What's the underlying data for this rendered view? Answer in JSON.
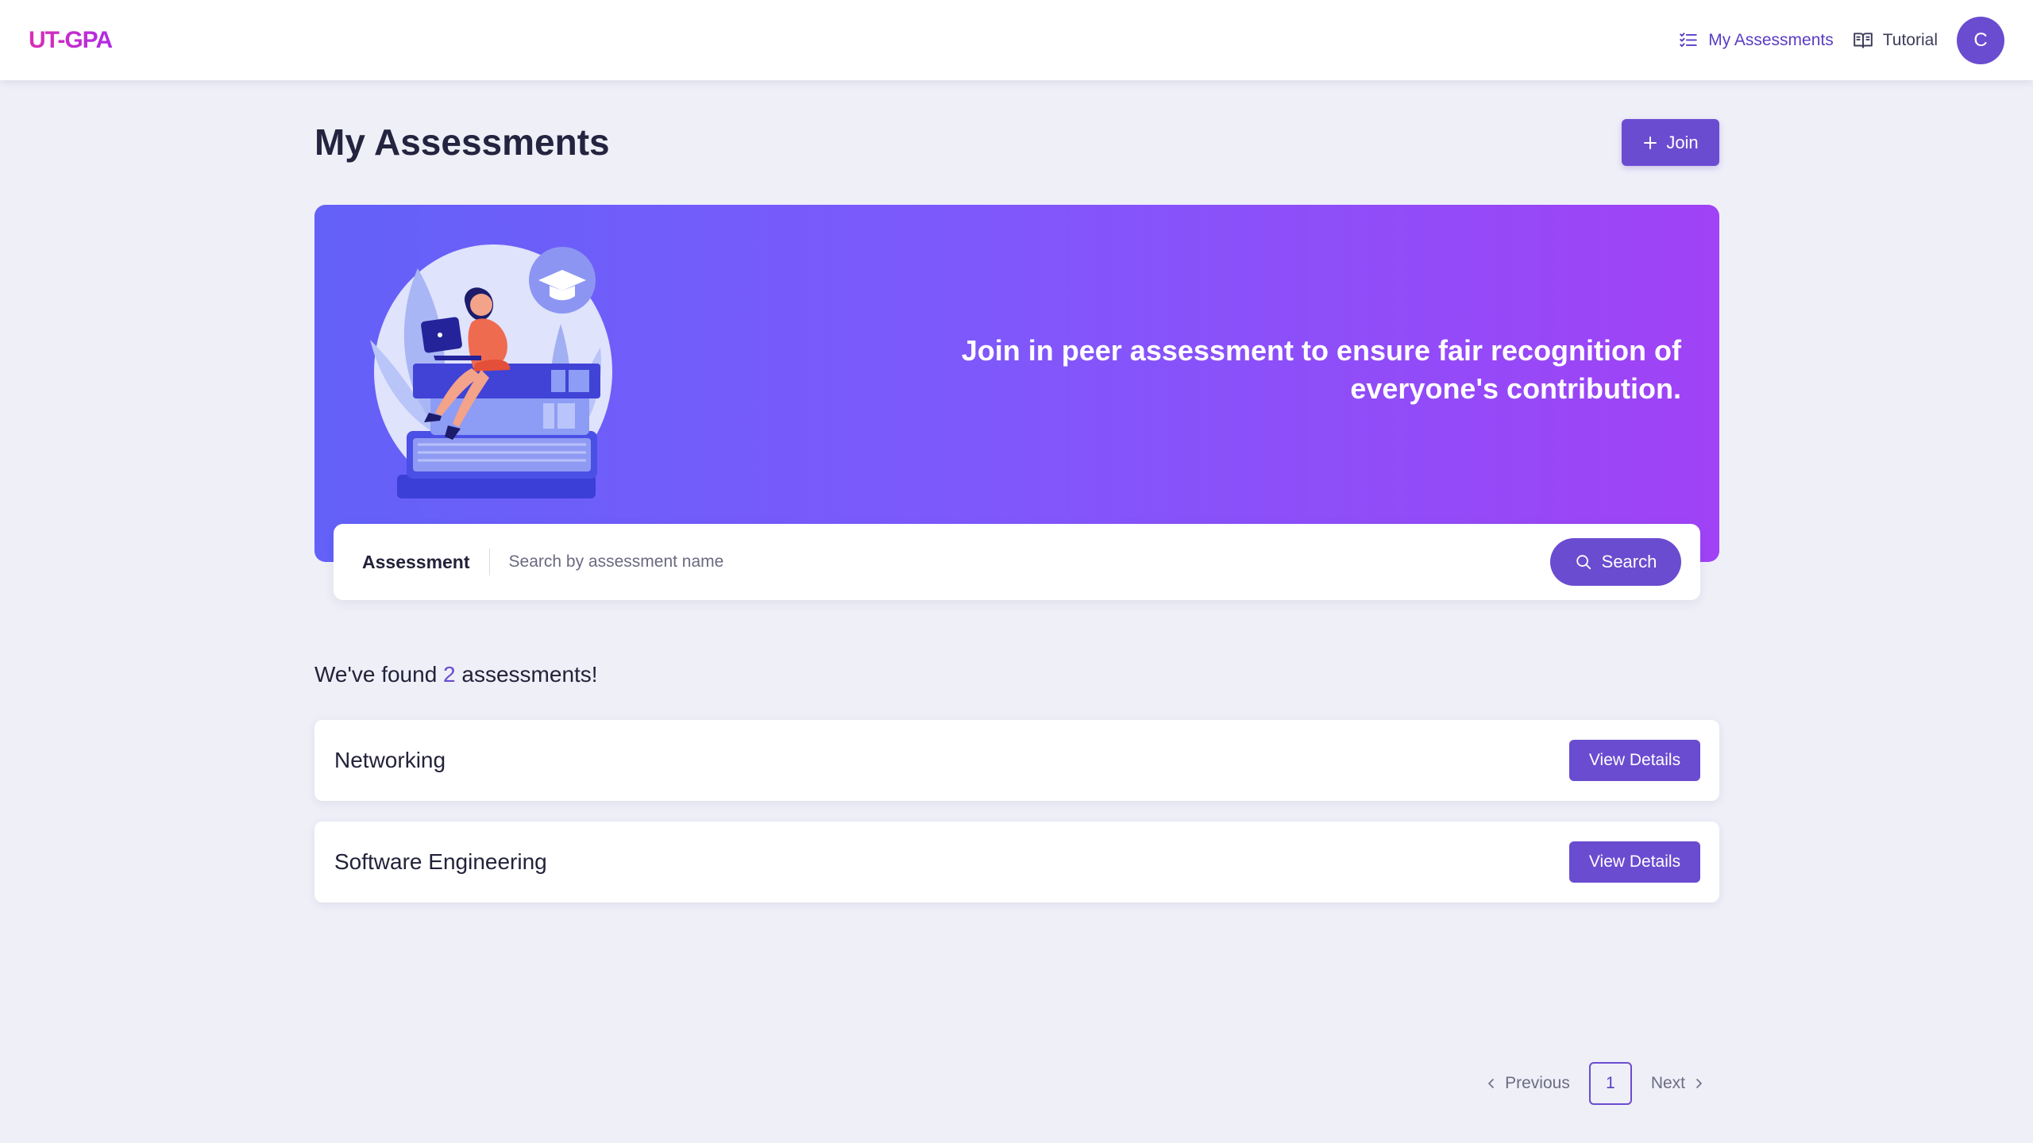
{
  "app": {
    "brand": "UT-GPA"
  },
  "nav": {
    "items": [
      {
        "label": "My Assessments",
        "icon": "list-check-icon"
      },
      {
        "label": "Tutorial",
        "icon": "book-icon"
      }
    ],
    "avatar_initial": "C"
  },
  "page": {
    "title": "My Assessments",
    "join_label": "Join"
  },
  "hero": {
    "text": "Join in peer assessment to ensure fair recognition of everyone's contribution.",
    "illustration": "person-on-books-illustration"
  },
  "search": {
    "label": "Assessment",
    "placeholder": "Search by assessment name",
    "value": "",
    "button_label": "Search"
  },
  "results": {
    "prefix": "We've found",
    "count": "2",
    "suffix": "assessments!",
    "items": [
      {
        "name": "Networking",
        "action": "View Details"
      },
      {
        "name": "Software Engineering",
        "action": "View Details"
      }
    ]
  },
  "pagination": {
    "previous": "Previous",
    "current": "1",
    "next": "Next"
  },
  "colors": {
    "accent": "#6a4cd0",
    "background": "#efeff8",
    "hero_start": "#6361f8",
    "hero_end": "#a042f6",
    "brand_pink": "#d92fb6"
  }
}
